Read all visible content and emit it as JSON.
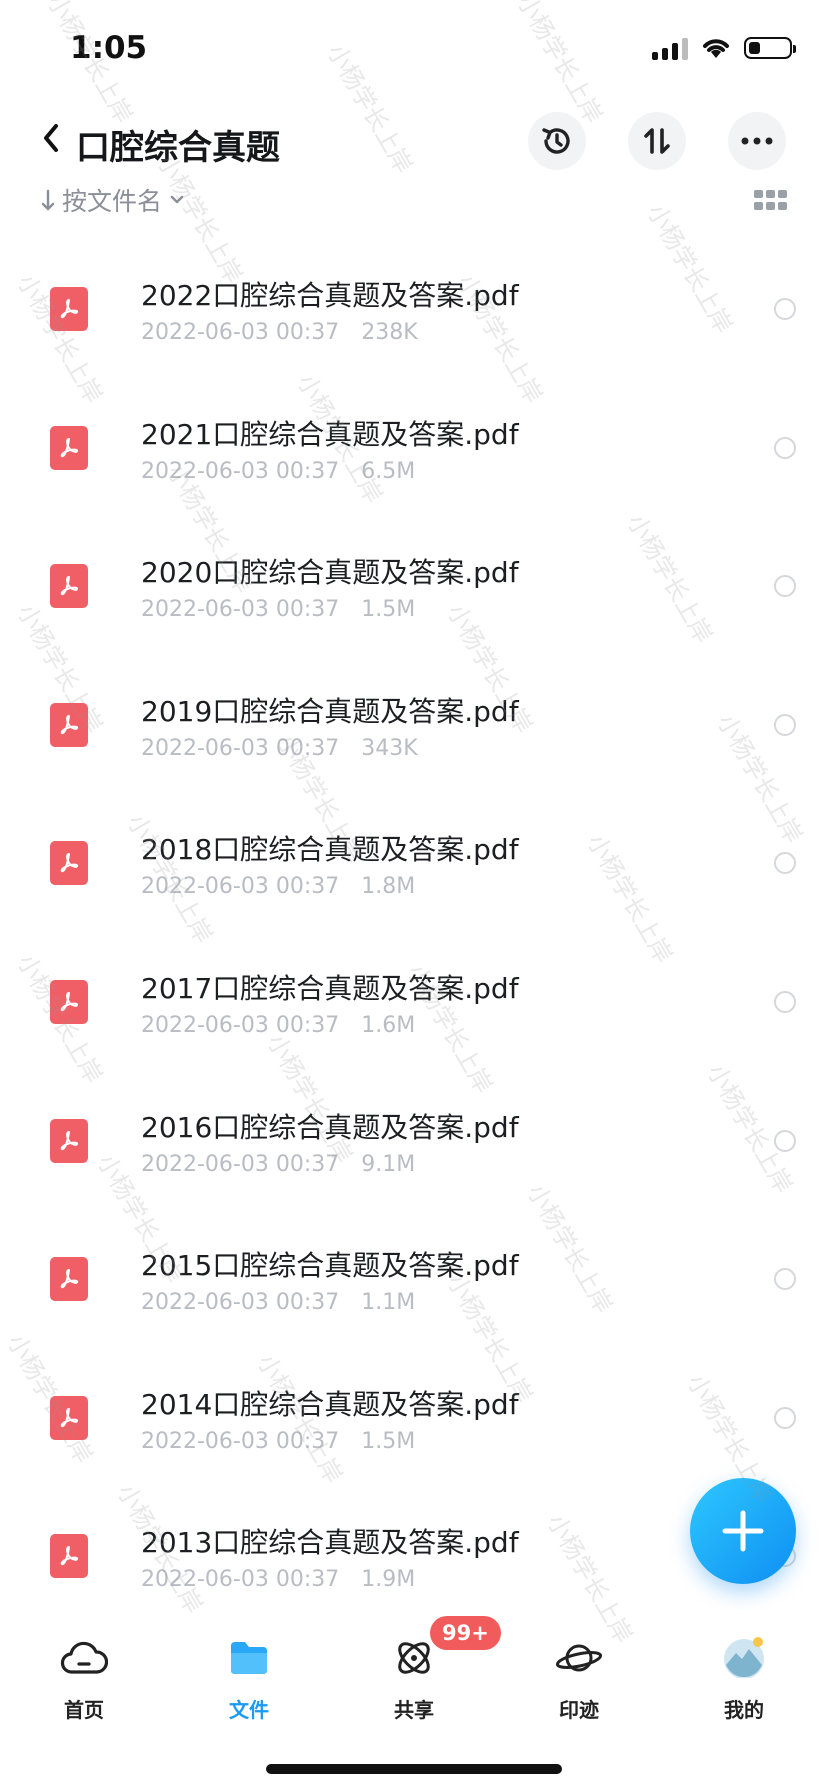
{
  "status_bar": {
    "time": "1:05"
  },
  "header": {
    "title": "口腔综合真题"
  },
  "sort": {
    "label": "按文件名"
  },
  "files": [
    {
      "name": "2022口腔综合真题及答案.pdf",
      "date": "2022-06-03 00:37",
      "size": "238K"
    },
    {
      "name": "2021口腔综合真题及答案.pdf",
      "date": "2022-06-03 00:37",
      "size": "6.5M"
    },
    {
      "name": "2020口腔综合真题及答案.pdf",
      "date": "2022-06-03 00:37",
      "size": "1.5M"
    },
    {
      "name": "2019口腔综合真题及答案.pdf",
      "date": "2022-06-03 00:37",
      "size": "343K"
    },
    {
      "name": "2018口腔综合真题及答案.pdf",
      "date": "2022-06-03 00:37",
      "size": "1.8M"
    },
    {
      "name": "2017口腔综合真题及答案.pdf",
      "date": "2022-06-03 00:37",
      "size": "1.6M"
    },
    {
      "name": "2016口腔综合真题及答案.pdf",
      "date": "2022-06-03 00:37",
      "size": "9.1M"
    },
    {
      "name": "2015口腔综合真题及答案.pdf",
      "date": "2022-06-03 00:37",
      "size": "1.1M"
    },
    {
      "name": "2014口腔综合真题及答案.pdf",
      "date": "2022-06-03 00:37",
      "size": "1.5M"
    },
    {
      "name": "2013口腔综合真题及答案.pdf",
      "date": "2022-06-03 00:37",
      "size": "1.9M"
    }
  ],
  "tabs": [
    {
      "label": "首页",
      "icon": "cloud-icon"
    },
    {
      "label": "文件",
      "icon": "folder-icon"
    },
    {
      "label": "共享",
      "icon": "share-orbit-icon"
    },
    {
      "label": "印迹",
      "icon": "planet-icon"
    },
    {
      "label": "我的",
      "icon": "avatar-icon"
    }
  ],
  "share_badge": "99+",
  "watermark": "小杨学长上岸",
  "colors": {
    "accent": "#1a9af5",
    "pdf": "#f05f66",
    "badge": "#f25b5b"
  }
}
